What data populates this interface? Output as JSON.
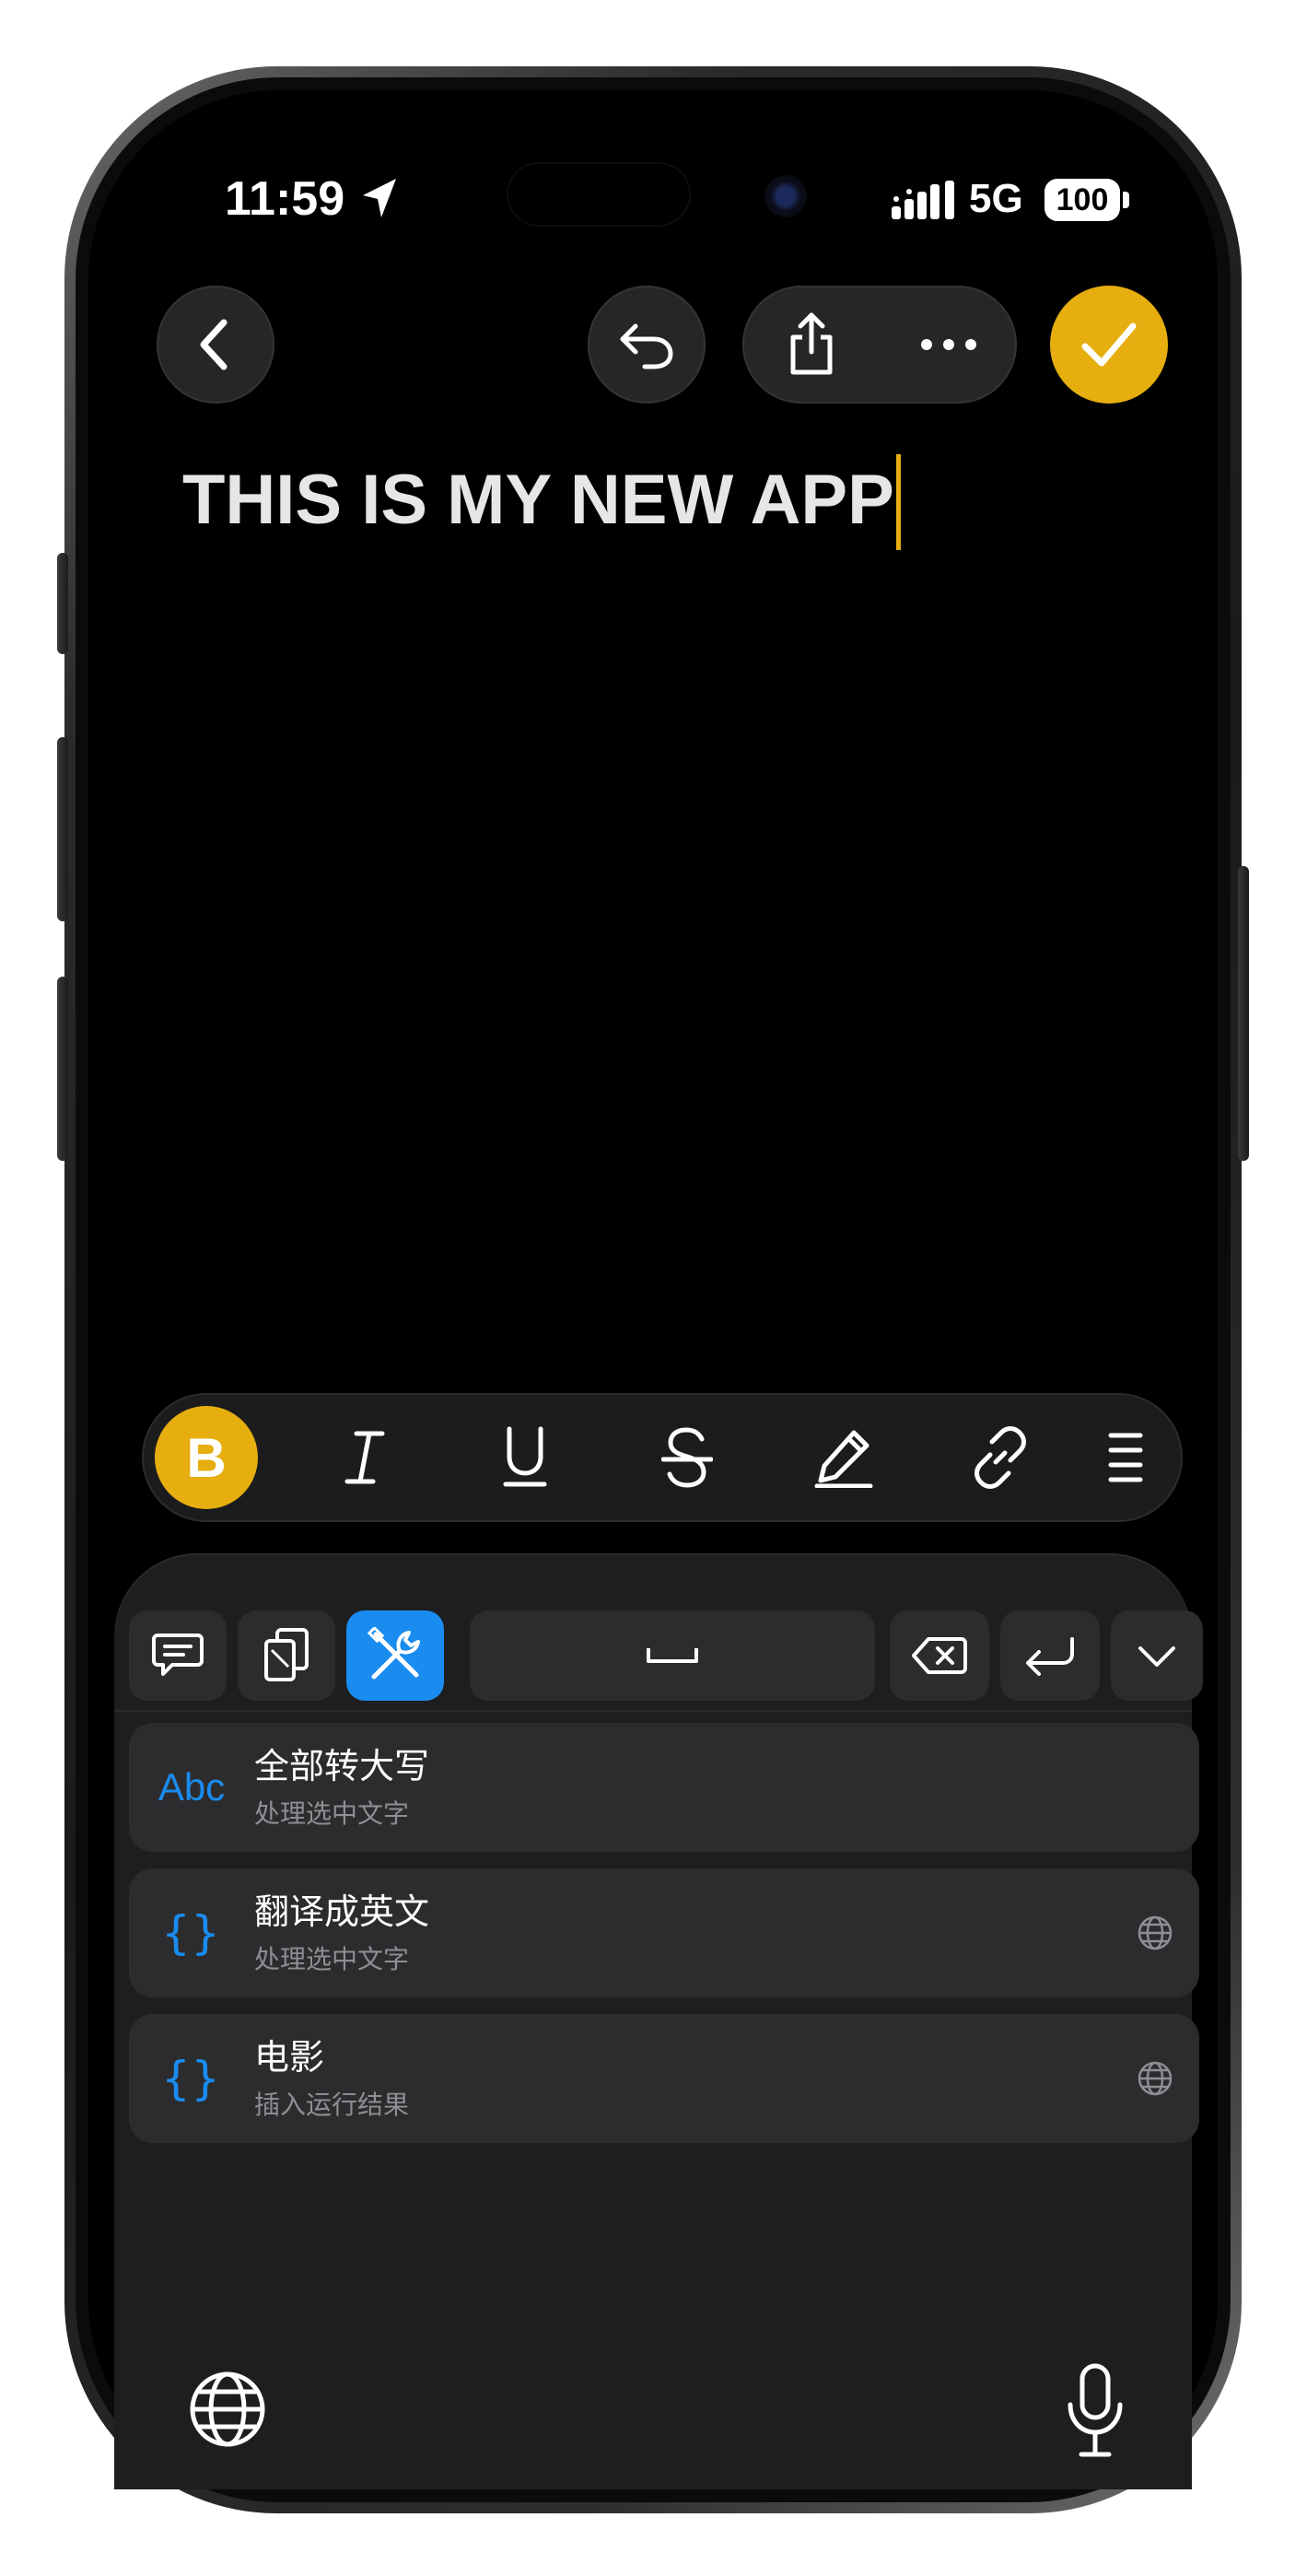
{
  "status_bar": {
    "time": "11:59",
    "network": "5G",
    "battery": "100",
    "location_icon": "location-arrow-icon",
    "signal_icon": "cellular-signal-icon"
  },
  "toolbar": {
    "back_icon": "chevron-left-icon",
    "undo_icon": "undo-icon",
    "share_icon": "share-icon",
    "more_icon": "ellipsis-icon",
    "confirm_icon": "checkmark-icon"
  },
  "document": {
    "title": "THIS IS MY NEW APP"
  },
  "format_bar": {
    "items": [
      {
        "label": "B",
        "icon": "bold-icon",
        "active": true
      },
      {
        "label": "I",
        "icon": "italic-icon"
      },
      {
        "label": "U",
        "icon": "underline-icon"
      },
      {
        "label": "S",
        "icon": "strikethrough-icon"
      },
      {
        "icon": "highlighter-pen-icon"
      },
      {
        "icon": "link-icon"
      },
      {
        "icon": "list-icon"
      }
    ]
  },
  "keyboard_toolbar": {
    "items": [
      {
        "icon": "comment-icon"
      },
      {
        "icon": "clipboard-icon"
      },
      {
        "icon": "tools-icon",
        "active": true
      },
      {
        "icon": "space-icon"
      },
      {
        "icon": "delete-backward-icon"
      },
      {
        "icon": "return-icon"
      },
      {
        "icon": "chevron-down-icon"
      }
    ]
  },
  "actions": [
    {
      "icon_text": "Abc",
      "title": "全部转大写",
      "subtitle": "处理选中文字",
      "has_globe": false
    },
    {
      "icon_text": "{}",
      "title": "翻译成英文",
      "subtitle": "处理选中文字",
      "has_globe": true
    },
    {
      "icon_text": "{}",
      "title": "电影",
      "subtitle": "插入运行结果",
      "has_globe": true
    }
  ],
  "keyboard_bottom": {
    "globe_icon": "globe-icon",
    "mic_icon": "microphone-icon"
  },
  "colors": {
    "accent": "#e6ae0e",
    "blue": "#1a8cf0",
    "background": "#000000"
  }
}
